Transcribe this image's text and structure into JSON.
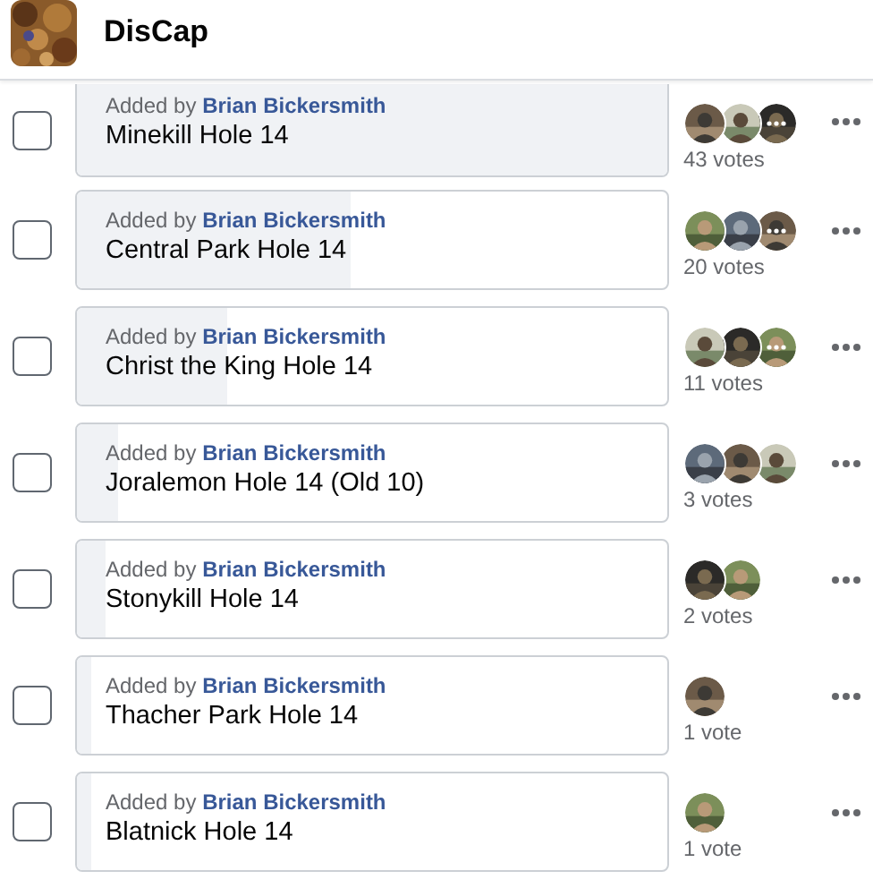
{
  "group": {
    "name": "DisCap",
    "avatar": {
      "kind": "picture"
    }
  },
  "options": [
    {
      "added_by_label": "Added by",
      "author": "Brian Bickersmith",
      "title": "Minekill Hole 14",
      "checked": false,
      "level": 1,
      "voters": [
        {
          "kind": "picture"
        },
        {
          "kind": "picture"
        },
        {
          "kind": "picture"
        }
      ],
      "more": true,
      "votes": "43 votes"
    },
    {
      "added_by_label": "Added by",
      "author": "Brian Bickersmith",
      "title": "Central Park Hole 14",
      "checked": false,
      "level": 0.465,
      "voters": [
        {
          "kind": "picture"
        },
        {
          "kind": "picture"
        },
        {
          "kind": "picture"
        }
      ],
      "more": true,
      "votes": "20 votes"
    },
    {
      "added_by_label": "Added by",
      "author": "Brian Bickersmith",
      "title": "Christ the King Hole 14",
      "checked": false,
      "level": 0.256,
      "voters": [
        {
          "kind": "picture"
        },
        {
          "kind": "picture"
        },
        {
          "kind": "picture"
        }
      ],
      "more": true,
      "votes": "11 votes"
    },
    {
      "added_by_label": "Added by",
      "author": "Brian Bickersmith",
      "title": "Joralemon Hole 14 (Old 10)",
      "checked": false,
      "level": 0.07,
      "voters": [
        {
          "kind": "picture"
        },
        {
          "kind": "picture"
        },
        {
          "kind": "picture"
        }
      ],
      "more": false,
      "votes": "3 votes"
    },
    {
      "added_by_label": "Added by",
      "author": "Brian Bickersmith",
      "title": "Stonykill Hole 14",
      "checked": false,
      "level": 0.047,
      "voters": [
        {
          "kind": "picture"
        },
        {
          "kind": "picture"
        }
      ],
      "more": false,
      "votes": "2 votes"
    },
    {
      "added_by_label": "Added by",
      "author": "Brian Bickersmith",
      "title": "Thacher Park Hole 14",
      "checked": false,
      "level": 0.023,
      "voters": [
        {
          "kind": "picture"
        }
      ],
      "more": false,
      "votes": "1 vote"
    },
    {
      "added_by_label": "Added by",
      "author": "Brian Bickersmith",
      "title": "Blatnick Hole 14",
      "checked": false,
      "level": 0.023,
      "voters": [
        {
          "kind": "picture"
        }
      ],
      "more": false,
      "votes": "1 vote"
    }
  ]
}
